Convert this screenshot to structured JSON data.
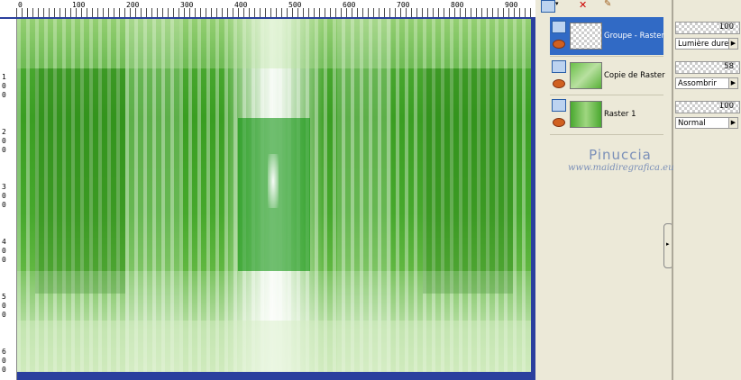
{
  "ruler": {
    "top_labels": [
      "0",
      "100",
      "200",
      "300",
      "400",
      "500",
      "600",
      "700",
      "800",
      "900"
    ],
    "left_labels": [
      "1",
      "0",
      "0",
      "2",
      "0",
      "0",
      "3",
      "0",
      "0",
      "4",
      "0",
      "0",
      "5",
      "0",
      "0",
      "6",
      "0",
      "0"
    ]
  },
  "layers": [
    {
      "name": "Groupe - Raster",
      "selected": true
    },
    {
      "name": "Copie de Raster",
      "selected": false
    },
    {
      "name": "Raster 1",
      "selected": false
    }
  ],
  "properties": [
    {
      "opacity": "100",
      "blend_mode": "Lumière dure"
    },
    {
      "opacity": "58",
      "blend_mode": "Assombrir"
    },
    {
      "opacity": "100",
      "blend_mode": "Normal"
    }
  ],
  "watermark": {
    "title": "Pinuccia",
    "url": "www.maidiregrafica.eu"
  },
  "colors": {
    "selection": "#316ac5",
    "panel_bg": "#ece9d8",
    "scroll_blue": "#2a3f9e",
    "image_green": "#46a82c"
  },
  "icons": {
    "layer_type": "raster-layer-icon",
    "visibility": "eye-icon",
    "delete": "delete-layer-icon",
    "new_layer": "new-layer-icon",
    "brush": "brush-icon"
  }
}
